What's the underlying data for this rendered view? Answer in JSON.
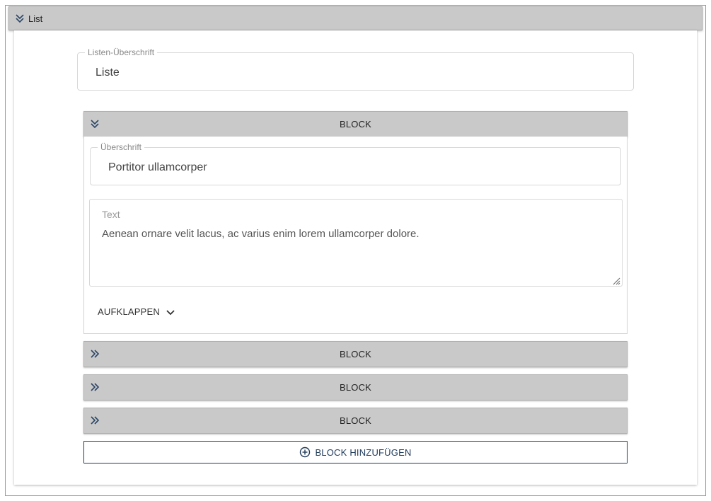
{
  "list": {
    "header_title": "List",
    "header_icon": "double-chevron-down-icon",
    "heading_field": {
      "label": "Listen-Überschrift",
      "value": "Liste"
    }
  },
  "blocks": [
    {
      "label": "BLOCK",
      "expanded": true,
      "icon": "double-chevron-down-icon",
      "heading_field": {
        "label": "Überschrift",
        "value": "Portitor ullamcorper"
      },
      "text_field": {
        "label": "Text",
        "value": "Aenean ornare velit lacus, ac varius enim lorem ullamcorper dolore."
      },
      "expand_label": "AUFKLAPPEN"
    },
    {
      "label": "BLOCK",
      "expanded": false,
      "icon": "double-chevron-right-icon"
    },
    {
      "label": "BLOCK",
      "expanded": false,
      "icon": "double-chevron-right-icon"
    },
    {
      "label": "BLOCK",
      "expanded": false,
      "icon": "double-chevron-right-icon"
    }
  ],
  "add_button": {
    "label": "BLOCK HINZUFÜGEN",
    "icon": "plus-circle-icon"
  },
  "colors": {
    "header_bg": "#c9c9c9",
    "icon_navy": "#2b4566",
    "button_border": "#1f3a5a"
  }
}
